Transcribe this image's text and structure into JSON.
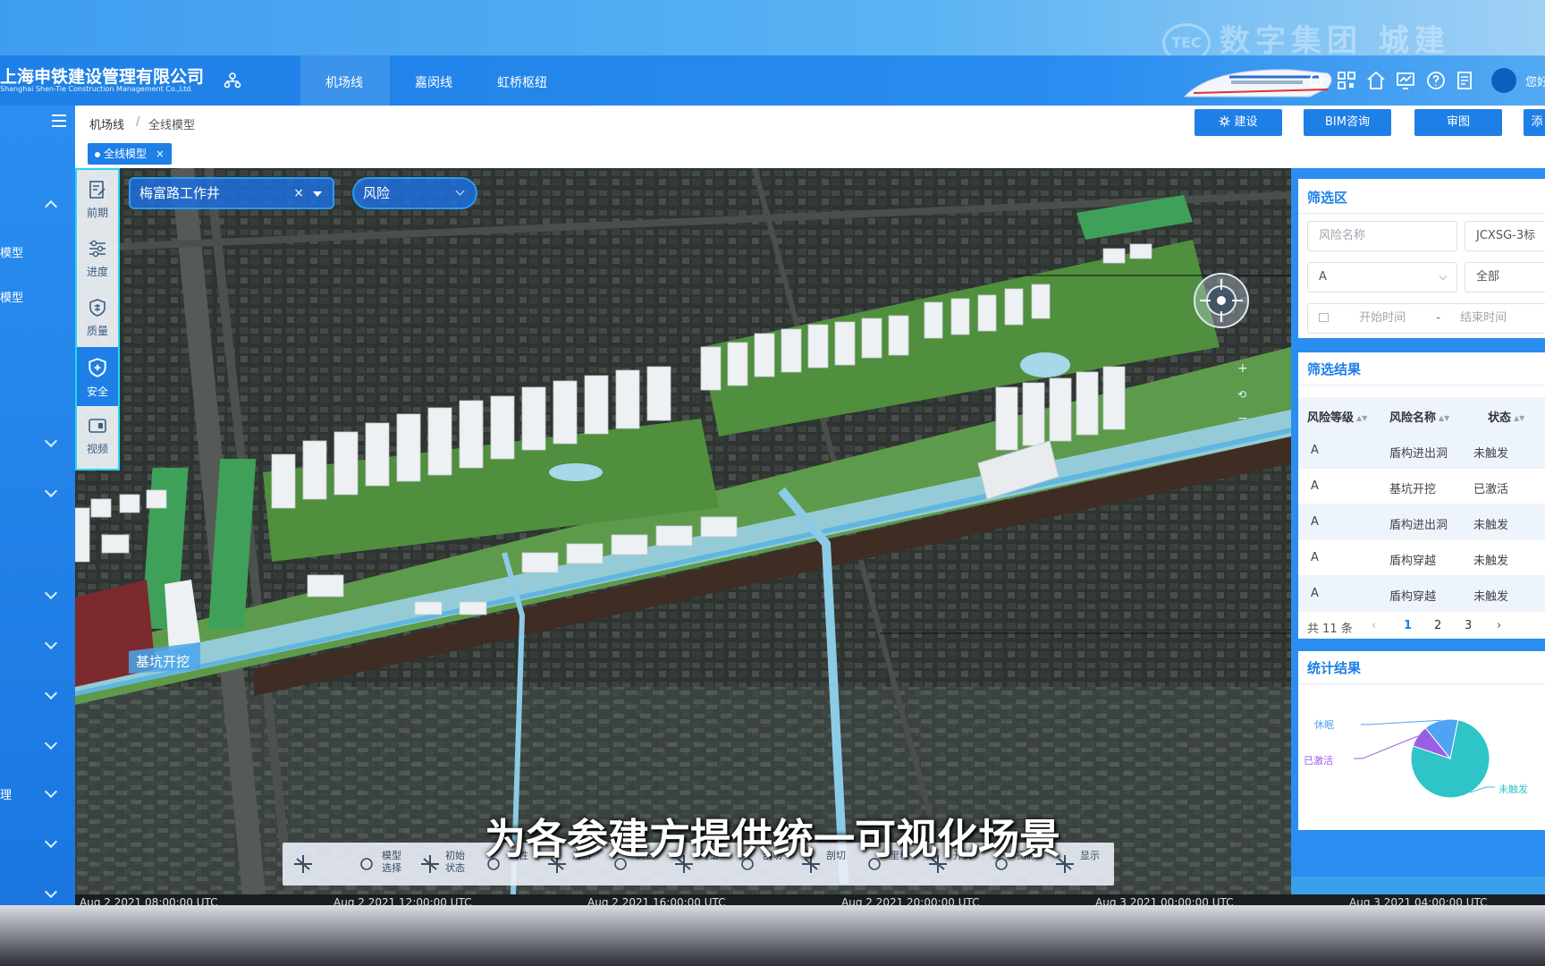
{
  "watermark": {
    "logo_text": "TEC",
    "text": "数字集团 城建"
  },
  "header": {
    "company_cn": "上海申铁建设管理有限公司",
    "company_en": "Shanghai Shen-Tie Construction Management Co.,Ltd.",
    "nav_tabs": [
      {
        "label": "机场线",
        "active": true
      },
      {
        "label": "嘉闵线",
        "active": false
      },
      {
        "label": "虹桥枢纽",
        "active": false
      }
    ],
    "user_text": "您好"
  },
  "left_sidebar": {
    "items": [
      "模型",
      "模型",
      "理"
    ]
  },
  "breadcrumb": {
    "root": "机场线",
    "separator": "/",
    "current": "全线模型"
  },
  "actions": {
    "build": "建设",
    "bim": "BIM咨询",
    "review": "审图",
    "more": "添"
  },
  "tab_tag": {
    "label": "全线模型",
    "close": "×"
  },
  "tool_rail": {
    "items": [
      {
        "label": "前期",
        "icon": "document-edit-icon",
        "active": false
      },
      {
        "label": "进度",
        "icon": "sliders-icon",
        "active": false
      },
      {
        "label": "质量",
        "icon": "quality-shield-icon",
        "active": false
      },
      {
        "label": "安全",
        "icon": "safety-shield-icon",
        "active": true
      },
      {
        "label": "视频",
        "icon": "video-icon",
        "active": false
      }
    ]
  },
  "map_controls": {
    "location_select": "梅富路工作井",
    "clear": "×",
    "category_select": "风险",
    "zoom_in": "+",
    "zoom_out": "−",
    "map_label": "基坑开挖"
  },
  "filter": {
    "title": "筛选区",
    "risk_name_placeholder": "风险名称",
    "section_value": "JCXSG-3标",
    "level_value": "A",
    "status_value": "全部",
    "start_placeholder": "开始时间",
    "range_sep": "-",
    "end_placeholder": "结束时间"
  },
  "results": {
    "title": "筛选结果",
    "columns": [
      "风险等级",
      "风险名称",
      "状态"
    ],
    "rows": [
      [
        "A",
        "盾构进出洞",
        "未触发"
      ],
      [
        "A",
        "基坑开挖",
        "已激活"
      ],
      [
        "A",
        "盾构进出洞",
        "未触发"
      ],
      [
        "A",
        "盾构穿越",
        "未触发"
      ],
      [
        "A",
        "盾构穿越",
        "未触发"
      ]
    ],
    "total": "共 11 条",
    "pages": [
      "1",
      "2",
      "3"
    ],
    "prev": "‹",
    "next": "›"
  },
  "stats": {
    "title": "统计结果",
    "labels": {
      "dormant": "休眠",
      "activated": "已激活",
      "untriggered": "未触发"
    }
  },
  "chart_data": {
    "type": "pie",
    "slices": [
      {
        "name": "未触发",
        "value": 0.77,
        "color": "#2ec4c8"
      },
      {
        "name": "已激活",
        "value": 0.09,
        "color": "#9b5de5"
      },
      {
        "name": "休眠",
        "value": 0.14,
        "color": "#4ea3f2"
      }
    ]
  },
  "bottom_toolbar": [
    {
      "label": "",
      "icon": "pan-icon"
    },
    {
      "label": "模型选择",
      "icon": "cubes-icon"
    },
    {
      "label": "初始状态",
      "icon": "reset-icon"
    },
    {
      "label": "属性",
      "icon": "info-icon"
    },
    {
      "label": "漫游",
      "icon": "walk-icon"
    },
    {
      "label": "测量",
      "icon": "measure-icon"
    },
    {
      "label": "测量",
      "icon": "ruler-icon"
    },
    {
      "label": "剖切",
      "icon": "cut-h-icon"
    },
    {
      "label": "剖切",
      "icon": "cut-v-icon"
    },
    {
      "label": "里程",
      "icon": "gauge-icon"
    },
    {
      "label": "开关",
      "icon": "layers-icon"
    },
    {
      "label": "摄影",
      "icon": "camera-icon"
    },
    {
      "label": "显示",
      "icon": "display-icon"
    }
  ],
  "timeline": [
    "Aug 2 2021 08:00:00 UTC",
    "Aug 2 2021 12:00:00 UTC",
    "Aug 2 2021 16:00:00 UTC",
    "Aug 2 2021 20:00:00 UTC",
    "Aug 3 2021 00:00:00 UTC",
    "Aug 3 2021 04:00:00 UTC"
  ],
  "subtitle": "为各参建方提供统一可视化场景"
}
